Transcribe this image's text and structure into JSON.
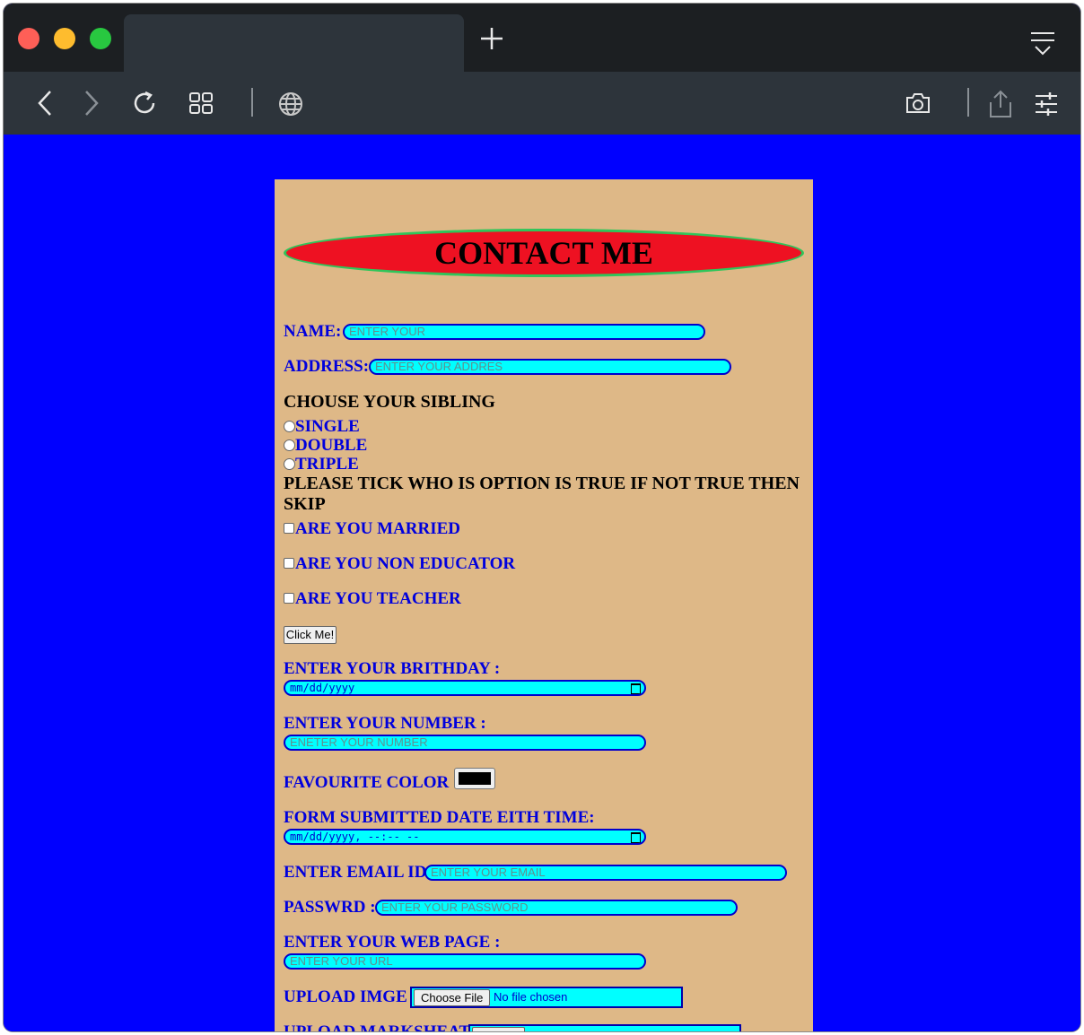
{
  "browser": {
    "icons": [
      "close-dot",
      "minimize-dot",
      "maximize-dot",
      "new-tab-plus",
      "tab-menu",
      "back-arrow",
      "forward-arrow",
      "reload",
      "tab-grid",
      "globe",
      "camera",
      "share",
      "settings-sliders"
    ]
  },
  "form": {
    "title": "CONTACT ME",
    "name": {
      "label": "NAME:",
      "placeholder": "ENTER YOUR"
    },
    "address": {
      "label": "ADDRESS:",
      "placeholder": "ENTER YOUR ADDRES"
    },
    "sibling": {
      "heading": "CHOUSE YOUR SIBLING",
      "options": [
        "SINGLE",
        " DOUBLE",
        "TRIPLE"
      ]
    },
    "tick": {
      "heading": "PLEASE TICK WHO IS OPTION IS TRUE IF NOT TRUE THEN SKIP",
      "options": [
        "ARE YOU MARRIED",
        "ARE YOU NON EDUCATOR",
        "ARE YOU TEACHER"
      ]
    },
    "button": "Click Me!",
    "birthday": {
      "label": "ENTER YOUR BRITHDAY :",
      "value": "mm/dd/yyyy"
    },
    "number": {
      "label": "ENTER YOUR NUMBER :",
      "placeholder": "ENETER YOUR NUMBER"
    },
    "color": {
      "label": "FAVOURITE COLOR :",
      "value": "#000000"
    },
    "submitted": {
      "label": "FORM SUBMITTED DATE EITH TIME:",
      "value": "mm/dd/yyyy, --:-- --"
    },
    "email": {
      "label": "ENTER EMAIL ID:",
      "placeholder": "ENTER YOUR EMAIL"
    },
    "password": {
      "label": "PASSWRD :",
      "placeholder": "ENTER YOUR PASSWORD"
    },
    "webpage": {
      "label": "ENTER YOUR WEB PAGE :",
      "placeholder": "ENTER YOUR URL"
    },
    "image": {
      "label": "UPLOAD IMGE :",
      "button": "Choose File",
      "status": "No file chosen"
    },
    "marksheet": {
      "label": "UPLOAD MARKSHEAT :"
    }
  },
  "colors": {
    "page_bg": "#0000ff",
    "form_bg": "#deb887",
    "banner_fill": "#ee1122",
    "banner_border": "#2fc55a",
    "input_bg": "#00ffff",
    "label_text": "#0000dd"
  }
}
